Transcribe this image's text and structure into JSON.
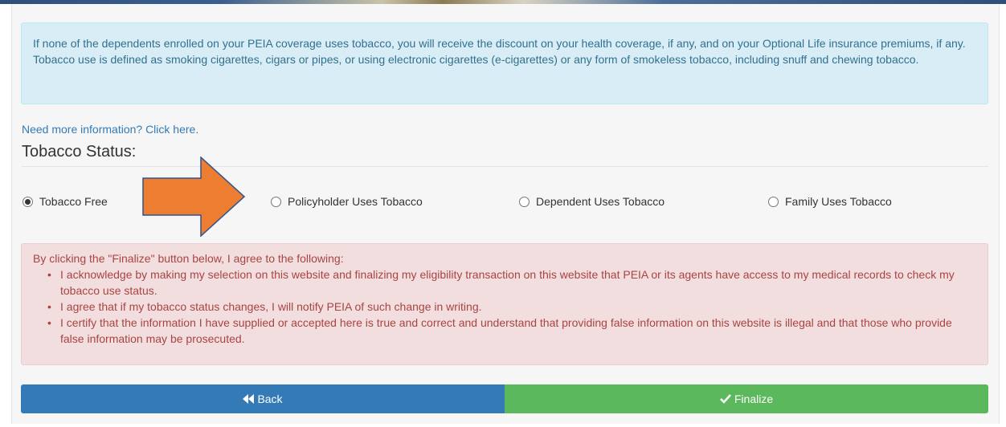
{
  "info_alert": {
    "text": "If none of the dependents enrolled on your PEIA coverage uses tobacco, you will receive the discount on your health coverage, if any, and on your Optional Life insurance premiums, if any. Tobacco use is defined as smoking cigarettes, cigars or pipes, or using electronic cigarettes (e-cigarettes) or any form of smokeless tobacco, including snuff and chewing tobacco."
  },
  "more_info_link": "Need more information? Click here.",
  "tobacco_status": {
    "heading": "Tobacco Status:",
    "options": [
      {
        "label": "Tobacco Free",
        "checked": true
      },
      {
        "label": "Policyholder Uses Tobacco",
        "checked": false
      },
      {
        "label": "Dependent Uses Tobacco",
        "checked": false
      },
      {
        "label": "Family Uses Tobacco",
        "checked": false
      }
    ]
  },
  "agreement": {
    "intro": "By clicking the \"Finalize\" button below, I agree to the following:",
    "items": [
      "I acknowledge by making my selection on this website and finalizing my eligibility transaction on this website that PEIA or its agents have access to my medical records to check my tobacco use status.",
      "I agree that if my tobacco status changes, I will notify PEIA of such change in writing.",
      "I certify that the information I have supplied or accepted here is true and correct and understand that providing false information on this website is illegal and that those who provide false information may be prosecuted."
    ]
  },
  "buttons": {
    "back_label": "Back",
    "back_icon": "fast-backward-icon",
    "finalize_label": "Finalize",
    "finalize_icon": "checkmark-icon"
  },
  "colors": {
    "info_bg": "#d9edf7",
    "info_text": "#31708f",
    "danger_bg": "#f2dede",
    "danger_text": "#a94442",
    "back_button": "#337ab7",
    "finalize_button": "#5cb85c",
    "arrow": "#ed7d31",
    "arrow_outline": "#2f528f"
  }
}
